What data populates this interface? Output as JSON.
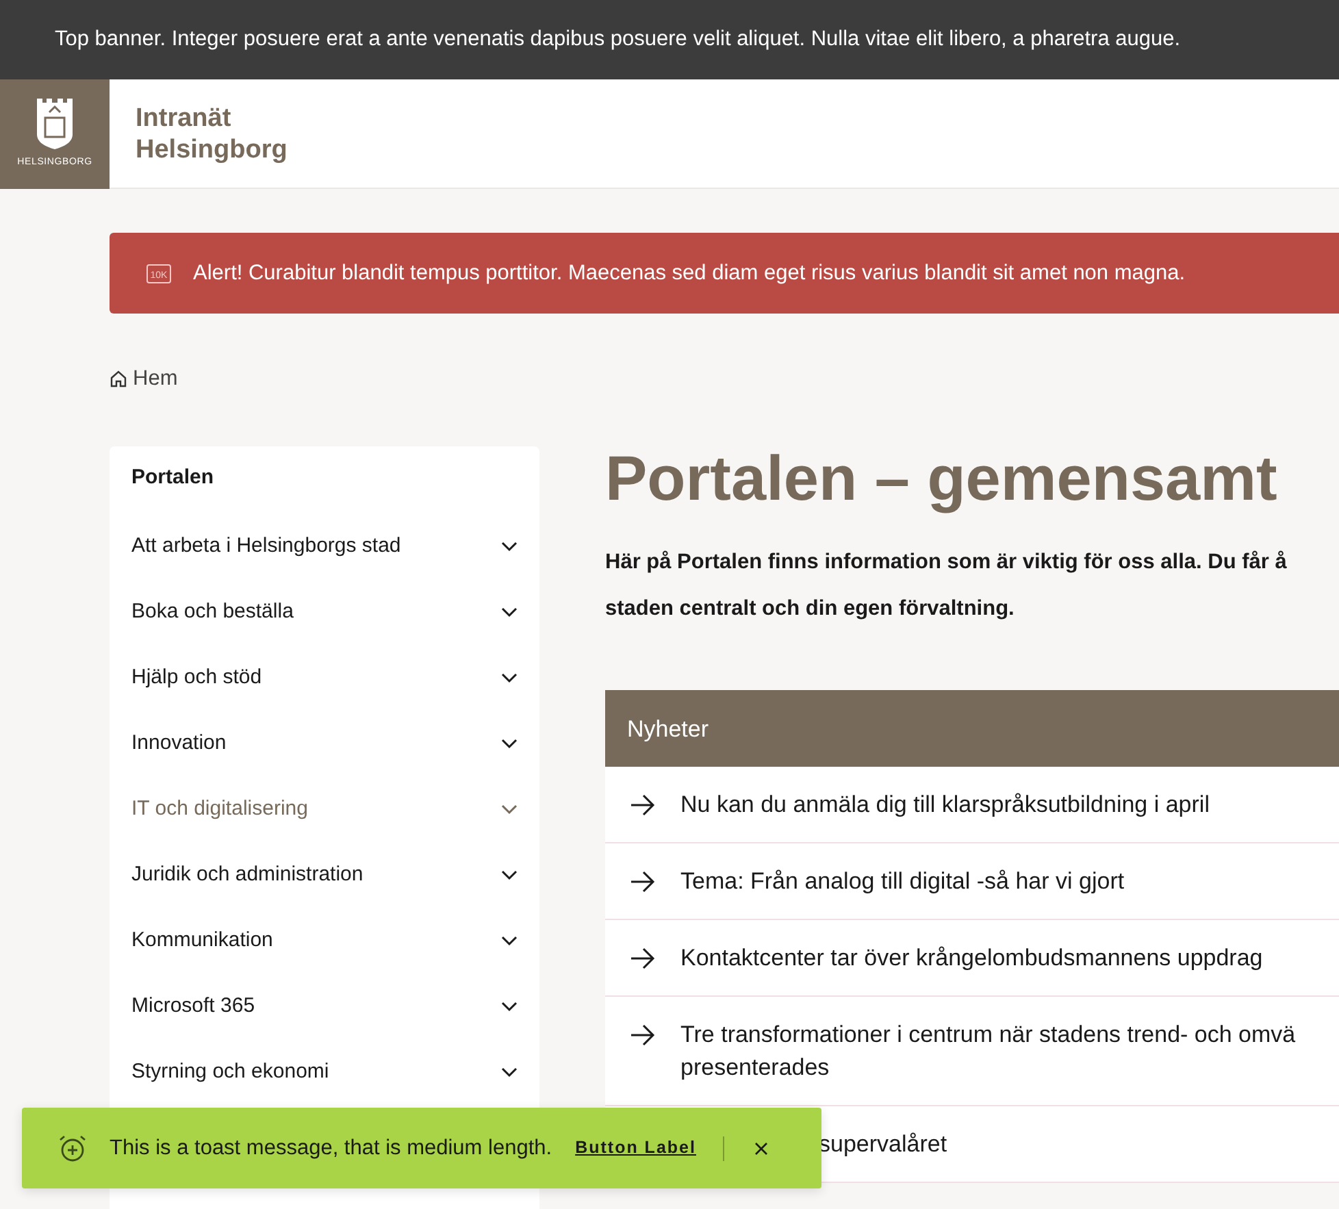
{
  "top_banner": {
    "text": "Top banner. Integer posuere erat a ante venenatis dapibus posuere velit aliquet. Nulla vitae elit libero, a pharetra augue."
  },
  "header": {
    "logo_text": "HELSINGBORG",
    "site_title_lines": [
      "Intranät",
      "Helsingborg"
    ]
  },
  "alert": {
    "icon_text": "10K",
    "text": "Alert! Curabitur blandit tempus porttitor. Maecenas sed diam eget risus varius blandit sit amet non magna."
  },
  "breadcrumb": [
    {
      "label": "Hem"
    }
  ],
  "sidebar": {
    "title": "Portalen",
    "items": [
      {
        "label": "Att arbeta i Helsingborgs stad",
        "selected": false
      },
      {
        "label": "Boka och beställa",
        "selected": false
      },
      {
        "label": "Hjälp och stöd",
        "selected": false
      },
      {
        "label": "Innovation",
        "selected": false
      },
      {
        "label": "IT och digitalisering",
        "selected": true
      },
      {
        "label": "Juridik och administration",
        "selected": false
      },
      {
        "label": "Kommunikation",
        "selected": false
      },
      {
        "label": "Microsoft 365",
        "selected": false
      },
      {
        "label": "Styrning och ekonomi",
        "selected": false
      }
    ]
  },
  "page": {
    "title": "Portalen – gemensamt",
    "intro_lines": [
      "Här på Portalen finns information som är viktig för oss alla. Du får å",
      "staden centralt och din egen förvaltning."
    ]
  },
  "news": {
    "title": "Nyheter",
    "items": [
      {
        "lines": [
          "Nu kan du anmäla dig till klarspråksutbildning i april"
        ]
      },
      {
        "lines": [
          "Tema: Från analog till digital -så har vi gjort"
        ]
      },
      {
        "lines": [
          "Kontaktcenter tar över krångelombudsmannens uppdrag"
        ]
      },
      {
        "lines": [
          "Tre transformationer i centrum när stadens trend- och omvä",
          "presenterades"
        ]
      },
      {
        "lines": [
          "supervalåret"
        ],
        "covered": true
      }
    ]
  },
  "toast": {
    "message": "This is a toast message, that is medium length.",
    "button": "Button Label"
  }
}
